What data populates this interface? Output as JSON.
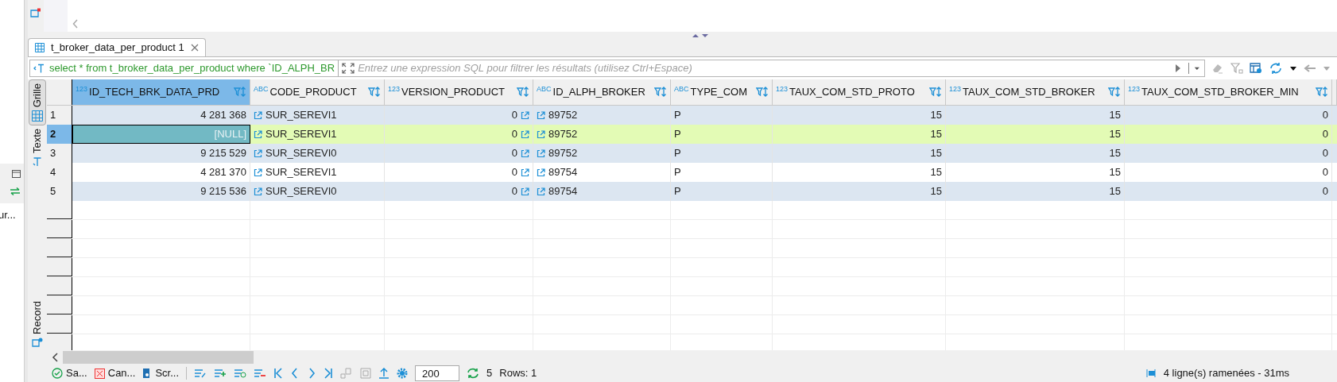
{
  "left_panel": {
    "item": "ur..."
  },
  "results_tab": {
    "title": "t_broker_data_per_product 1",
    "selected": true
  },
  "filter": {
    "query": "select * from t_broker_data_per_product where `ID_ALPH_BR",
    "placeholder": "Entrez une expression SQL pour filtrer les résultats (utilisez Ctrl+Espace)"
  },
  "view_tabs": [
    {
      "label": "Grille",
      "selected": true
    },
    {
      "label": "Texte",
      "selected": false
    }
  ],
  "record_tab": {
    "label": "Record"
  },
  "columns": [
    {
      "name": "ID_TECH_BRK_DATA_PRD",
      "type_label": "123",
      "kind": "key",
      "selected": true
    },
    {
      "name": "CODE_PRODUCT",
      "type_label": "ABC",
      "kind": "text",
      "selected": false
    },
    {
      "name": "VERSION_PRODUCT",
      "type_label": "123",
      "kind": "number_link",
      "selected": false
    },
    {
      "name": "ID_ALPH_BROKER",
      "type_label": "ABC",
      "kind": "text",
      "selected": false
    },
    {
      "name": "TYPE_COM",
      "type_label": "ABC",
      "kind": "plain",
      "selected": false
    },
    {
      "name": "TAUX_COM_STD_PROTO",
      "type_label": "123",
      "kind": "number",
      "selected": false
    },
    {
      "name": "TAUX_COM_STD_BROKER",
      "type_label": "123",
      "kind": "number",
      "selected": false
    },
    {
      "name": "TAUX_COM_STD_BROKER_MIN",
      "type_label": "123",
      "kind": "number",
      "selected": false
    }
  ],
  "rows": [
    {
      "number": "1",
      "selected": false,
      "focused_cell": false,
      "null_first": false,
      "cells": [
        "4 281 368",
        "SUR_SEREVI1",
        "0",
        "89752",
        "P",
        "15",
        "15",
        "0"
      ]
    },
    {
      "number": "2",
      "selected": true,
      "focused_cell": true,
      "null_first": true,
      "cells": [
        "[NULL]",
        "SUR_SEREVI1",
        "0",
        "89752",
        "P",
        "15",
        "15",
        "0"
      ]
    },
    {
      "number": "3",
      "selected": false,
      "focused_cell": false,
      "null_first": false,
      "cells": [
        "9 215 529",
        "SUR_SEREVI0",
        "0",
        "89752",
        "P",
        "15",
        "15",
        "0"
      ]
    },
    {
      "number": "4",
      "selected": false,
      "focused_cell": false,
      "null_first": false,
      "cells": [
        "4 281 370",
        "SUR_SEREVI1",
        "0",
        "89754",
        "P",
        "15",
        "15",
        "0"
      ]
    },
    {
      "number": "5",
      "selected": false,
      "focused_cell": false,
      "null_first": false,
      "cells": [
        "9 215 536",
        "SUR_SEREVI0",
        "0",
        "89754",
        "P",
        "15",
        "15",
        "0"
      ]
    }
  ],
  "toolbar": {
    "save": "Sa...",
    "cancel": "Can...",
    "script": "Scr...",
    "fetch_size": "200",
    "refresh_count": "5",
    "rows_label": "Rows: 1"
  },
  "status": "4 ligne(s) ramenées - 31ms"
}
